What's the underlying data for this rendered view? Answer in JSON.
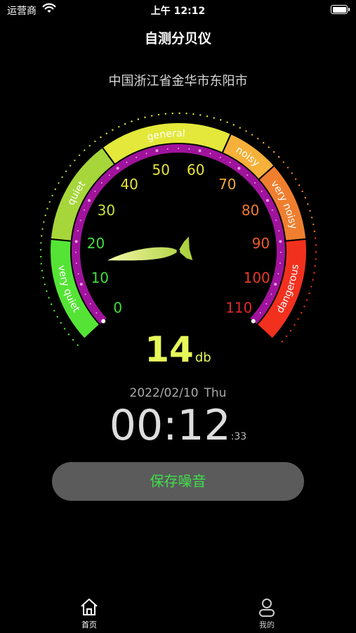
{
  "status_bar": {
    "carrier": "运营商",
    "time": "上午 12:12"
  },
  "nav": {
    "title": "自测分贝仪"
  },
  "location": "中国浙江省金华市东阳市",
  "gauge": {
    "needle_value": 14,
    "scale_min": 0,
    "scale_max": 110,
    "ticks": [
      "0",
      "10",
      "20",
      "30",
      "40",
      "50",
      "60",
      "70",
      "80",
      "90",
      "100",
      "110"
    ],
    "tick_colors": [
      "#3ede3a",
      "#3ede3a",
      "#3ede3a",
      "#c8e23a",
      "#e7e43a",
      "#e7e43a",
      "#e7e43a",
      "#f2a83a",
      "#ef7a2e",
      "#ee5c2a",
      "#e83a2a",
      "#e0282a"
    ],
    "bands": [
      {
        "label": "very quiet",
        "from": 0,
        "to": 20,
        "color": "#55e436"
      },
      {
        "label": "quiet",
        "from": 20,
        "to": 40,
        "color": "#a6d63a"
      },
      {
        "label": "general",
        "from": 40,
        "to": 65,
        "color": "#e3e83a"
      },
      {
        "label": "noisy",
        "from": 65,
        "to": 75,
        "color": "#f5b13a"
      },
      {
        "label": "very noisy",
        "from": 75,
        "to": 90,
        "color": "#ef7f2f"
      },
      {
        "label": "dangerous",
        "from": 90,
        "to": 110,
        "color": "#f2301e"
      }
    ],
    "accent_color": "#a0139c"
  },
  "reading": {
    "value": "14",
    "unit": "db"
  },
  "date": {
    "date": "2022/02/10",
    "weekday": "Thu"
  },
  "time": {
    "main": "00:12",
    "seconds": ":33"
  },
  "save_button": {
    "label": "保存噪音"
  },
  "tab_bar": {
    "items": [
      {
        "label": "首页",
        "icon": "home-icon"
      },
      {
        "label": "我的",
        "icon": "user-icon"
      }
    ]
  }
}
